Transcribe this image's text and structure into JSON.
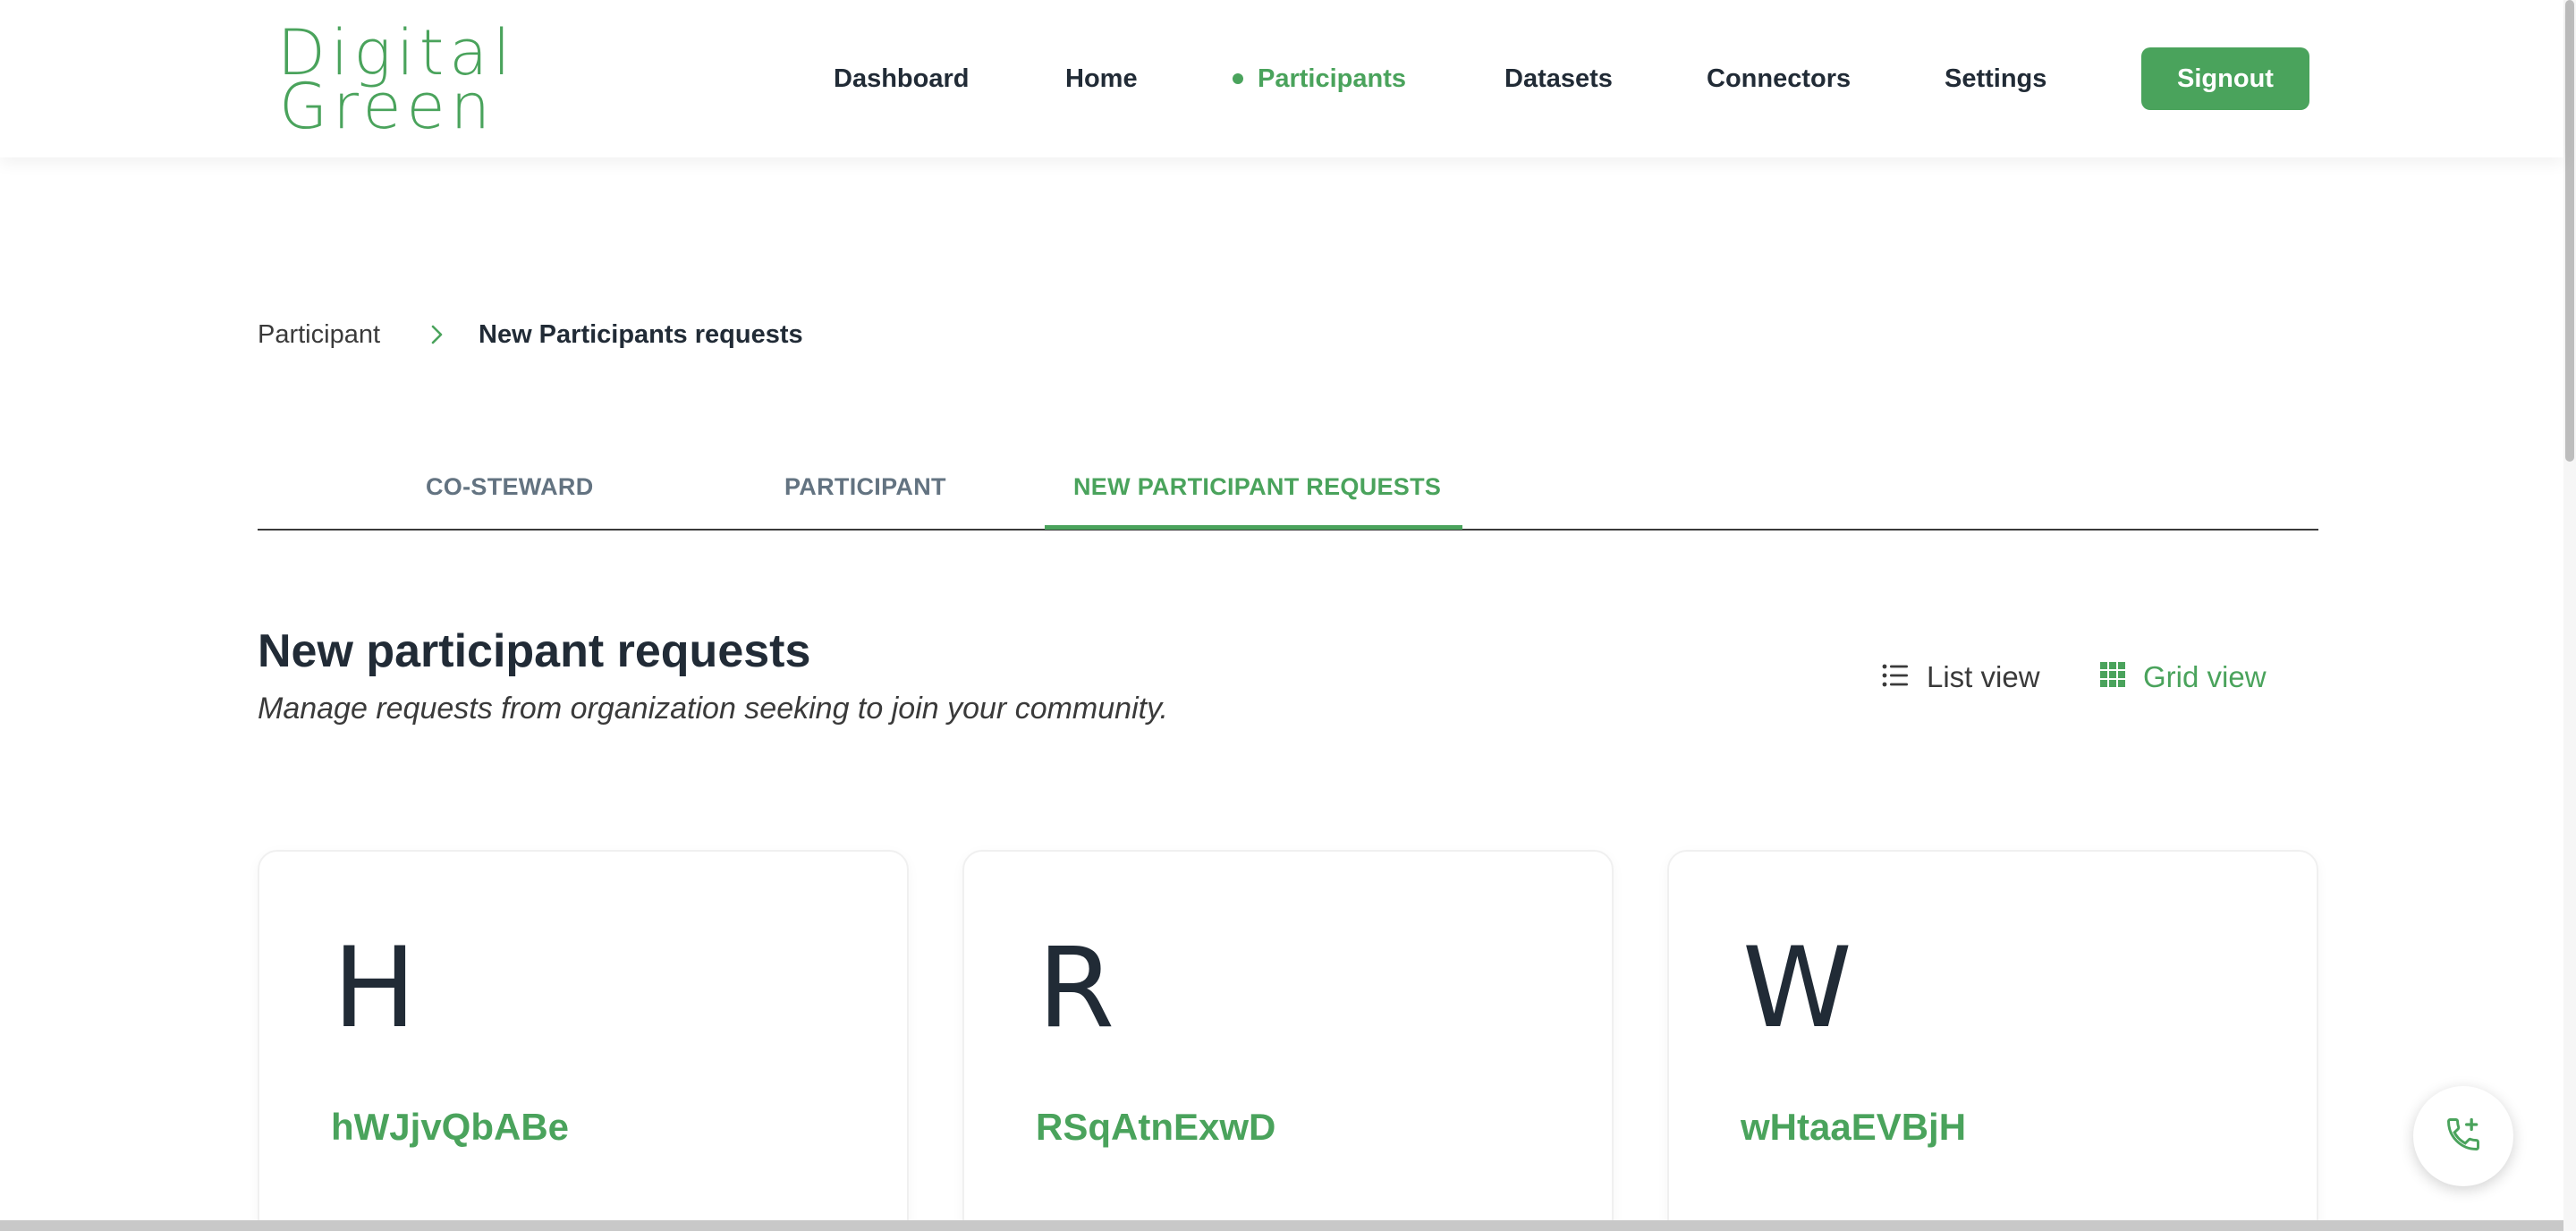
{
  "brand": {
    "line1": "Digital",
    "line2": "Green",
    "accent_color": "#4aa35c"
  },
  "nav": {
    "items": [
      {
        "label": "Dashboard"
      },
      {
        "label": "Home"
      },
      {
        "label": "Participants",
        "active": true
      },
      {
        "label": "Datasets"
      },
      {
        "label": "Connectors"
      },
      {
        "label": "Settings"
      }
    ],
    "signout_label": "Signout"
  },
  "breadcrumb": {
    "parent": "Participant",
    "current": "New Participants requests"
  },
  "tabs": [
    {
      "label": "CO-STEWARD"
    },
    {
      "label": "PARTICIPANT"
    },
    {
      "label": "NEW PARTICIPANT REQUESTS",
      "active": true
    }
  ],
  "section": {
    "title": "New participant requests",
    "subtitle": "Manage requests from organization seeking to join your community."
  },
  "views": {
    "list_label": "List view",
    "grid_label": "Grid view",
    "selected": "Grid view"
  },
  "cards": [
    {
      "initial": "H",
      "name": "hWJjvQbABe"
    },
    {
      "initial": "R",
      "name": "RSqAtnExwD"
    },
    {
      "initial": "W",
      "name": "wHtaaEVBjH"
    }
  ],
  "icons": {
    "breadcrumb_separator": "chevron-right-icon",
    "list_view": "list-icon",
    "grid_view": "grid-icon",
    "floating_button": "phone-add-icon"
  }
}
